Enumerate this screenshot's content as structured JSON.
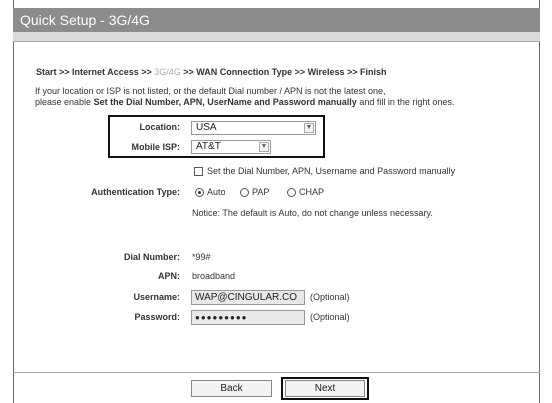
{
  "title": "Quick Setup - 3G/4G",
  "breadcrumb": {
    "start": "Start >> Internet Access >> ",
    "current": "3G/4G",
    "rest": " >> WAN Connection Type >> Wireless >> Finish"
  },
  "intro": {
    "line1": "If your location or ISP is not listed, or the default Dial number / APN is not the latest one,",
    "line2_prefix": "please enable ",
    "line2_bold": "Set the Dial Number, APN, UserName and Password manually",
    "line2_suffix": " and fill in the right ones."
  },
  "location": {
    "label": "Location:",
    "value": "USA"
  },
  "mobile_isp": {
    "label": "Mobile ISP:",
    "value": "AT&T"
  },
  "manual_checkbox": {
    "label": "Set the Dial Number, APN, Username and Password manually",
    "checked": false
  },
  "auth": {
    "label": "Authentication Type:",
    "options": [
      "Auto",
      "PAP",
      "CHAP"
    ],
    "selected": "Auto",
    "notice": "Notice: The default is Auto, do not change unless necessary."
  },
  "dial_number": {
    "label": "Dial Number:",
    "value": "*99#"
  },
  "apn": {
    "label": "APN:",
    "value": "broadband"
  },
  "username": {
    "label": "Username:",
    "value": "WAP@CINGULAR.CO",
    "hint": "(Optional)"
  },
  "password": {
    "label": "Password:",
    "value": "●●●●●●●●●",
    "hint": "(Optional)"
  },
  "buttons": {
    "back": "Back",
    "next": "Next"
  }
}
